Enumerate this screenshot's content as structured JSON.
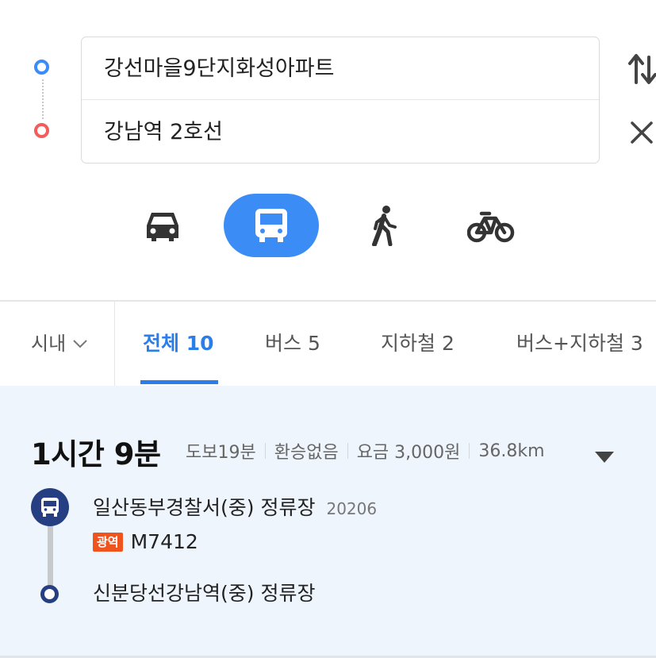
{
  "route": {
    "origin": "강선마을9단지화성아파트",
    "destination": "강남역 2호선"
  },
  "modes": [
    {
      "icon": "car-icon",
      "selected": false
    },
    {
      "icon": "bus-icon",
      "selected": true
    },
    {
      "icon": "walk-icon",
      "selected": false
    },
    {
      "icon": "bicycle-icon",
      "selected": false
    }
  ],
  "colors": {
    "accent": "#3b8cf5",
    "start_marker": "#3b8cf5",
    "end_marker": "#f25c5c",
    "active_tab": "#2b7de9",
    "route_type_badge": "#f0541e",
    "bus_stop_marker": "#263f82",
    "result_background": "#eef5fc"
  },
  "filters": {
    "region": "시내",
    "tabs": [
      {
        "label": "전체 10",
        "active": true
      },
      {
        "label": "버스 5",
        "active": false
      },
      {
        "label": "지하철 2",
        "active": false
      },
      {
        "label": "버스+지하철 3",
        "active": false
      }
    ]
  },
  "result": {
    "duration": "1시간 9분",
    "walk": "도보19분",
    "transfer": "환승없음",
    "fare": "요금 3,000원",
    "distance": "36.8km",
    "start_stop": {
      "name": "일산동부경찰서(중) 정류장",
      "id": "20206"
    },
    "route_type": "광역",
    "route_number": "M7412",
    "end_stop": {
      "name": "신분당선강남역(중) 정류장"
    }
  }
}
